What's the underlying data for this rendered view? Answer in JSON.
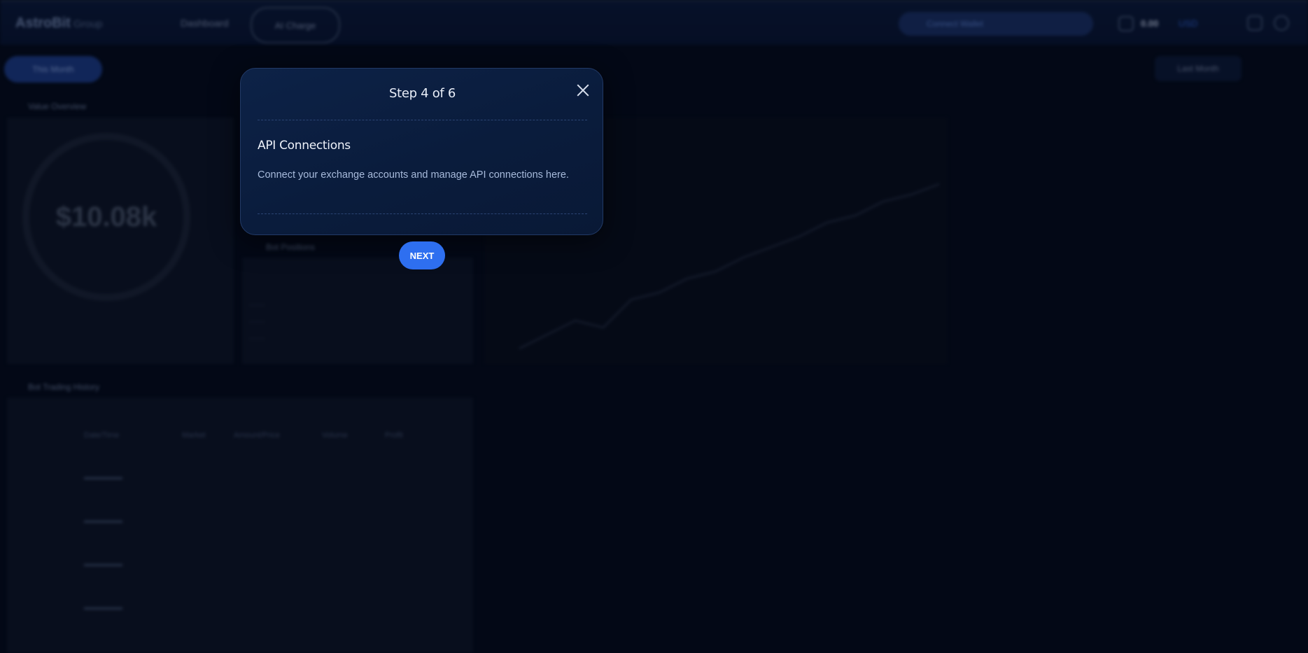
{
  "app": {
    "logo": "AstroBit",
    "logo_sub": "Group",
    "nav_dashboard": "Dashboard",
    "nav_pill": "AI Charge",
    "connect_label": "Connect Wallet",
    "balance_label": "0.00",
    "balance_amount": "USD",
    "period_label": "This Month",
    "right_select": "Last Month",
    "value_panel_title": "Value Overview",
    "big_value": "$10.08k",
    "bot_panel_title": "Bot Positions",
    "trading_panel_title": "Bot Trading History",
    "table_headers": [
      "Date/Time",
      "Market",
      "Amount/Price",
      "Volume",
      "Profit"
    ]
  },
  "tour": {
    "step_label": "Step 4 of 6",
    "heading": "API Connections",
    "description": "Connect your exchange accounts and manage API connections here.",
    "next_label": "NEXT"
  },
  "colors": {
    "modal_bg": "#0d2247",
    "accent": "#2e6ff0",
    "page_bg": "#040a17"
  }
}
